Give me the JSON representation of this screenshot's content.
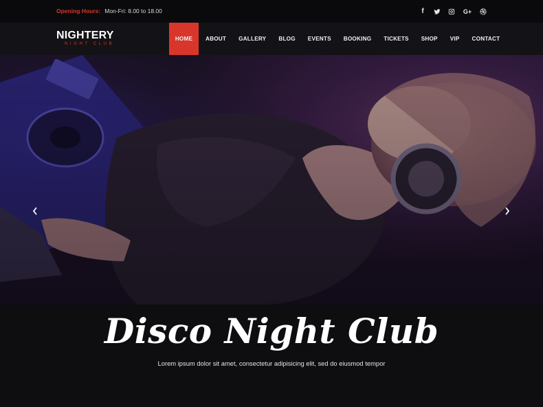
{
  "topbar": {
    "hours_label": "Opening Hours:",
    "hours_value": "Mon-Fri: 8.00 to 18.00",
    "social": [
      {
        "icon": "facebook-icon",
        "glyph": "f"
      },
      {
        "icon": "twitter-icon",
        "glyph": ""
      },
      {
        "icon": "instagram-icon",
        "glyph": ""
      },
      {
        "icon": "google-plus-icon",
        "glyph": "G+"
      },
      {
        "icon": "dribbble-icon",
        "glyph": ""
      }
    ]
  },
  "logo": {
    "main": "NIGHTERY",
    "sub": "NIGHT CLUB"
  },
  "nav": {
    "items": [
      "HOME",
      "ABOUT",
      "GALLERY",
      "BLOG",
      "EVENTS",
      "BOOKING",
      "TICKETS",
      "SHOP",
      "VIP",
      "CONTACT"
    ],
    "active": "HOME"
  },
  "hero": {
    "title": "Disco Night Club",
    "subtitle": "Lorem ipsum dolor sit amet, consectetur adipisicing elit, sed do eiusmod tempor"
  },
  "colors": {
    "accent": "#d9362b",
    "header_bg": "#131216",
    "topbar_bg": "#0a090c"
  }
}
